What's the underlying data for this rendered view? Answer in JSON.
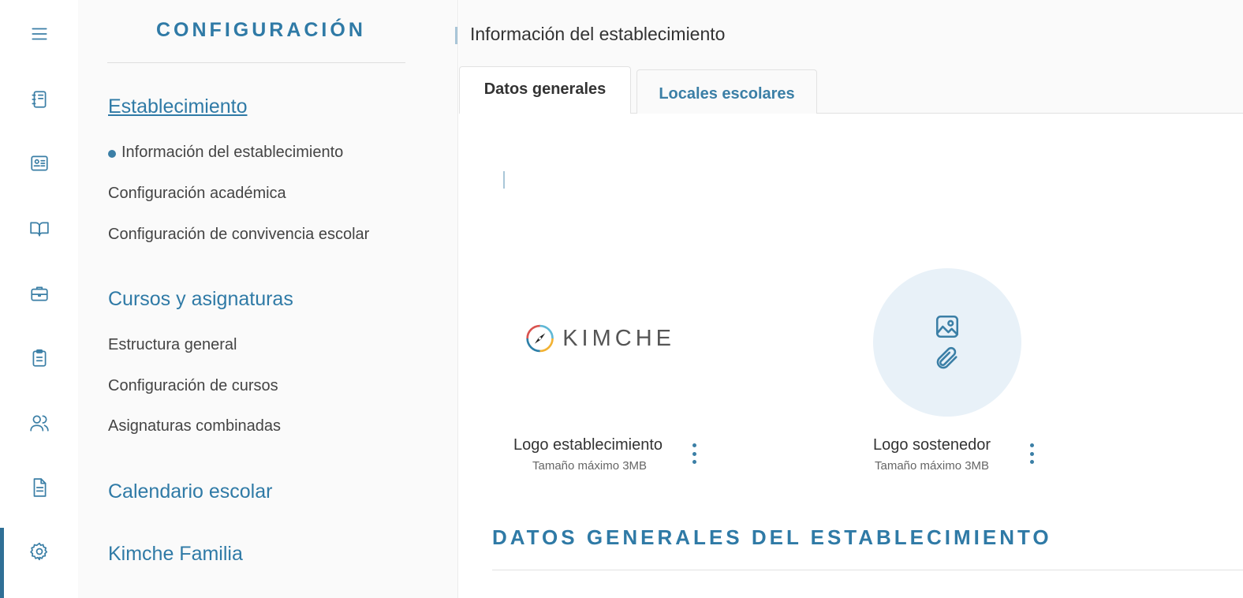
{
  "rail": {
    "items": [
      {
        "icon": "menu-icon"
      },
      {
        "icon": "notebook-icon"
      },
      {
        "icon": "id-card-icon"
      },
      {
        "icon": "open-book-icon"
      },
      {
        "icon": "briefcase-icon"
      },
      {
        "icon": "clipboard-icon"
      },
      {
        "icon": "users-icon"
      },
      {
        "icon": "document-icon"
      },
      {
        "icon": "gear-icon",
        "active": true
      }
    ]
  },
  "sidebar": {
    "title": "CONFIGURACIÓN",
    "sections": [
      {
        "label": "Establecimiento",
        "active": true,
        "items": [
          {
            "label": "Información del establecimiento",
            "active": true
          },
          {
            "label": "Configuración académica"
          },
          {
            "label": "Configuración de convivencia escolar"
          }
        ]
      },
      {
        "label": "Cursos y asignaturas",
        "items": [
          {
            "label": "Estructura general"
          },
          {
            "label": "Configuración de cursos"
          },
          {
            "label": "Asignaturas combinadas"
          }
        ]
      },
      {
        "label": "Calendario escolar",
        "items": []
      },
      {
        "label": "Kimche Familia",
        "items": []
      }
    ]
  },
  "main": {
    "title": "Información del establecimiento",
    "tabs": [
      {
        "label": "Datos generales",
        "active": true
      },
      {
        "label": "Locales escolares"
      }
    ],
    "logos": [
      {
        "label": "Logo establecimiento",
        "hint": "Tamaño máximo 3MB",
        "brand_text": "KIMCHE"
      },
      {
        "label": "Logo sostenedor",
        "hint": "Tamaño máximo 3MB"
      }
    ],
    "section_heading": "DATOS GENERALES DEL ESTABLECIMIENTO"
  },
  "colors": {
    "accent": "#2f7aa6",
    "icon": "#3b7fa6",
    "upload_bg": "#e8f1f8",
    "sidebar_bg": "#fafafa"
  }
}
